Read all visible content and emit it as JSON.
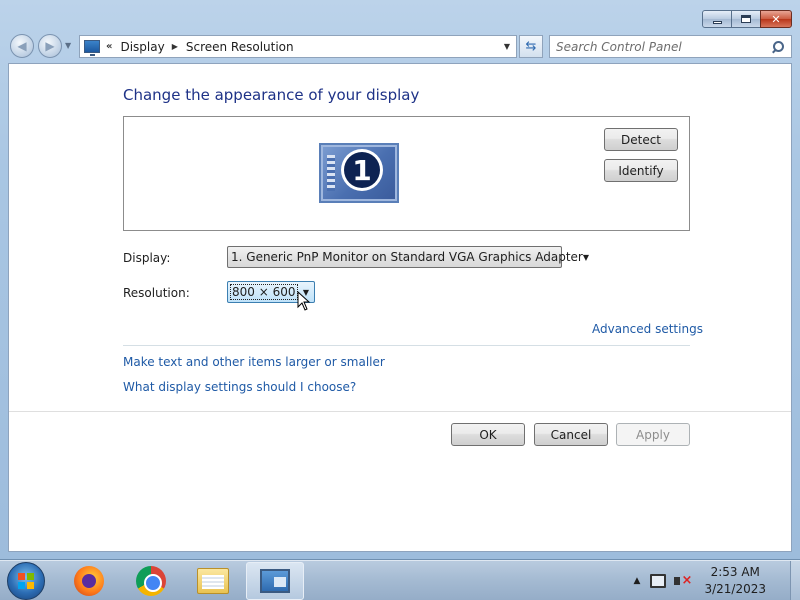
{
  "window": {
    "controls": {
      "minimize": "minimize",
      "maximize": "maximize",
      "close": "close"
    }
  },
  "navigation": {
    "breadcrumb": [
      "Display",
      "Screen Resolution"
    ],
    "search_placeholder": "Search Control Panel"
  },
  "main": {
    "title": "Change the appearance of your display",
    "monitor_number": "1",
    "detect_label": "Detect",
    "identify_label": "Identify",
    "display_label": "Display:",
    "display_value": "1. Generic PnP Monitor on Standard VGA Graphics Adapter",
    "resolution_label": "Resolution:",
    "resolution_value": "800 × 600",
    "advanced_link": "Advanced settings",
    "larger_link": "Make text and other items larger or smaller",
    "help_link": "What display settings should I choose?"
  },
  "footer": {
    "ok_label": "OK",
    "cancel_label": "Cancel",
    "apply_label": "Apply",
    "apply_enabled": false
  },
  "taskbar": {
    "apps": [
      "start-orb",
      "firefox-icon",
      "chrome-icon",
      "file-explorer-icon",
      "display-settings-icon"
    ],
    "active_app": "display-settings-icon",
    "clock": {
      "time": "2:53 AM",
      "date": "3/21/2023"
    }
  },
  "colors": {
    "accent": "#1e3287",
    "link": "#1f5aa6",
    "selection": "#3c7fb1"
  }
}
